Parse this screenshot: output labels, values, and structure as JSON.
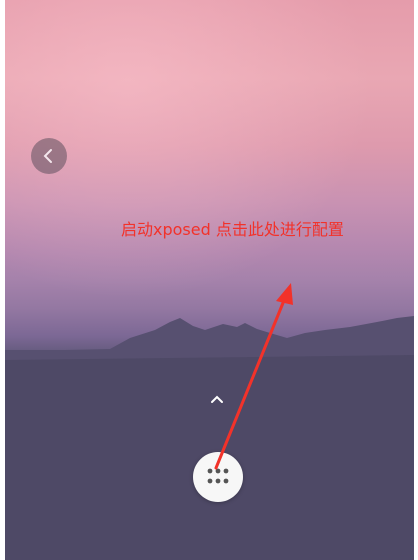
{
  "annotation": {
    "text": "启动xposed 点击此处进行配置",
    "color": "#f2322a"
  },
  "icons": {
    "back": "chevron-left-icon",
    "up": "chevron-up-icon",
    "app_drawer": "grid-dots-icon"
  },
  "colors": {
    "sky_top": "#e59cab",
    "mountains": "#5d5676",
    "ground": "#4f4a66"
  }
}
